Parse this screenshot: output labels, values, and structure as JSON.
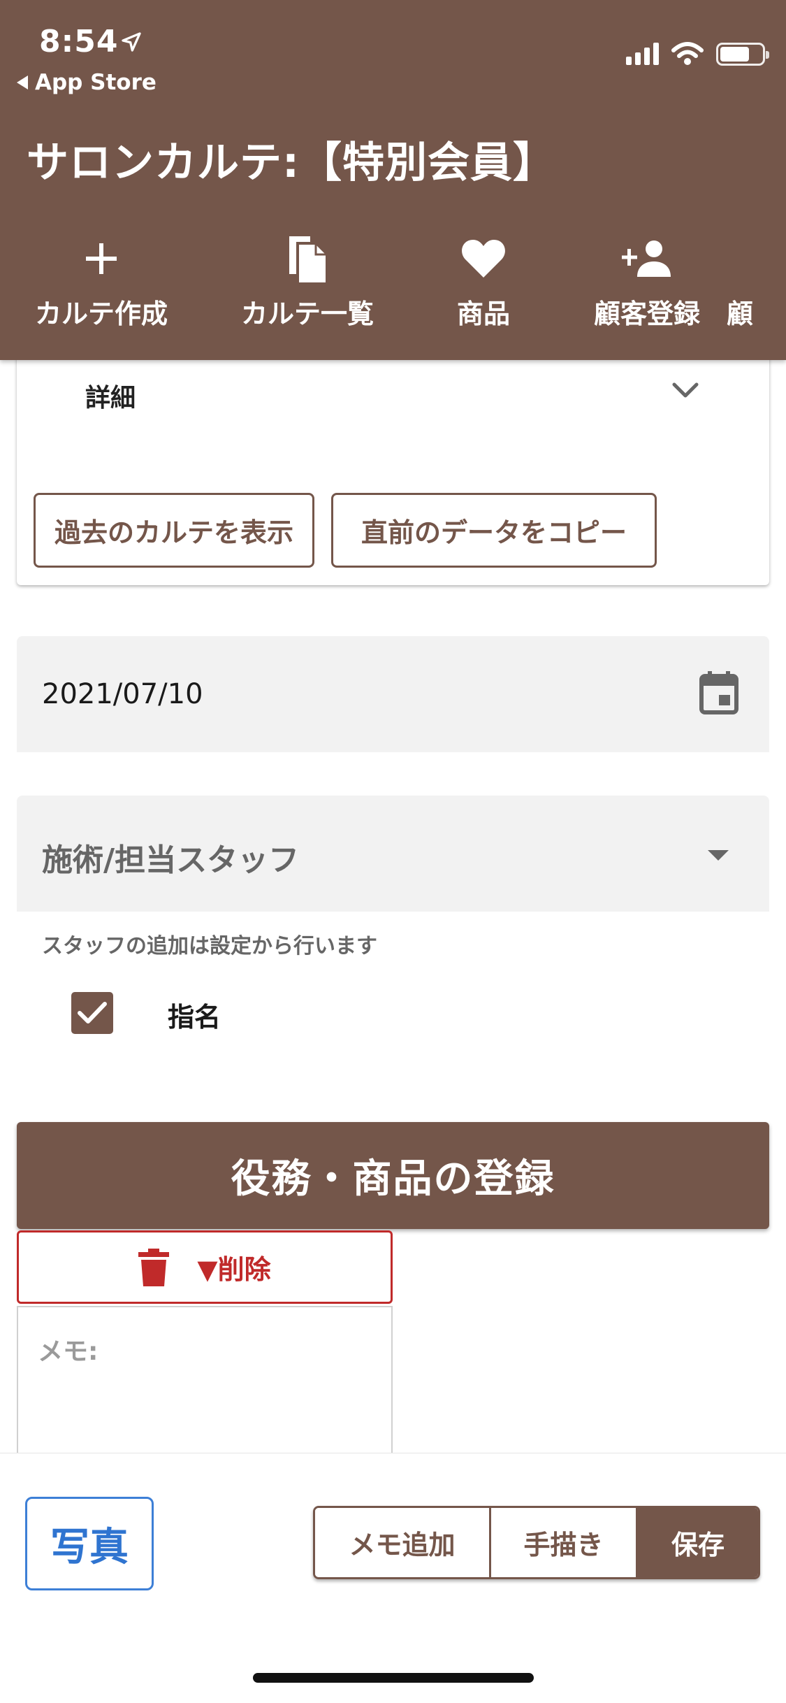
{
  "status_bar": {
    "time": "8:54",
    "back_label": "App Store"
  },
  "header": {
    "title": "サロンカルテ:【特別会員】",
    "nav": [
      {
        "label": "カルテ作成",
        "icon": "plus-icon"
      },
      {
        "label": "カルテ一覧",
        "icon": "copy-icon"
      },
      {
        "label": "商品",
        "icon": "heart-icon"
      },
      {
        "label": "顧客登録",
        "icon": "add-person-icon"
      },
      {
        "label": "顧",
        "icon": ""
      }
    ]
  },
  "detail": {
    "label": "詳細",
    "past_button": "過去のカルテを表示",
    "copy_button": "直前のデータをコピー"
  },
  "date_field": {
    "value": "2021/07/10"
  },
  "staff_field": {
    "label": "施術/担当スタッフ",
    "hint": "スタッフの追加は設定から行います"
  },
  "nomination": {
    "label": "指名",
    "checked": true
  },
  "register": {
    "label": "役務・商品の登録"
  },
  "delete_button": {
    "label": "▼削除"
  },
  "memo": {
    "label": "メモ:"
  },
  "bottom": {
    "photo": "写真",
    "add_memo": "メモ追加",
    "handwrite": "手描き",
    "save": "保存"
  },
  "colors": {
    "primary": "#74564a",
    "danger": "#c02a2a",
    "link": "#2f74d0"
  }
}
